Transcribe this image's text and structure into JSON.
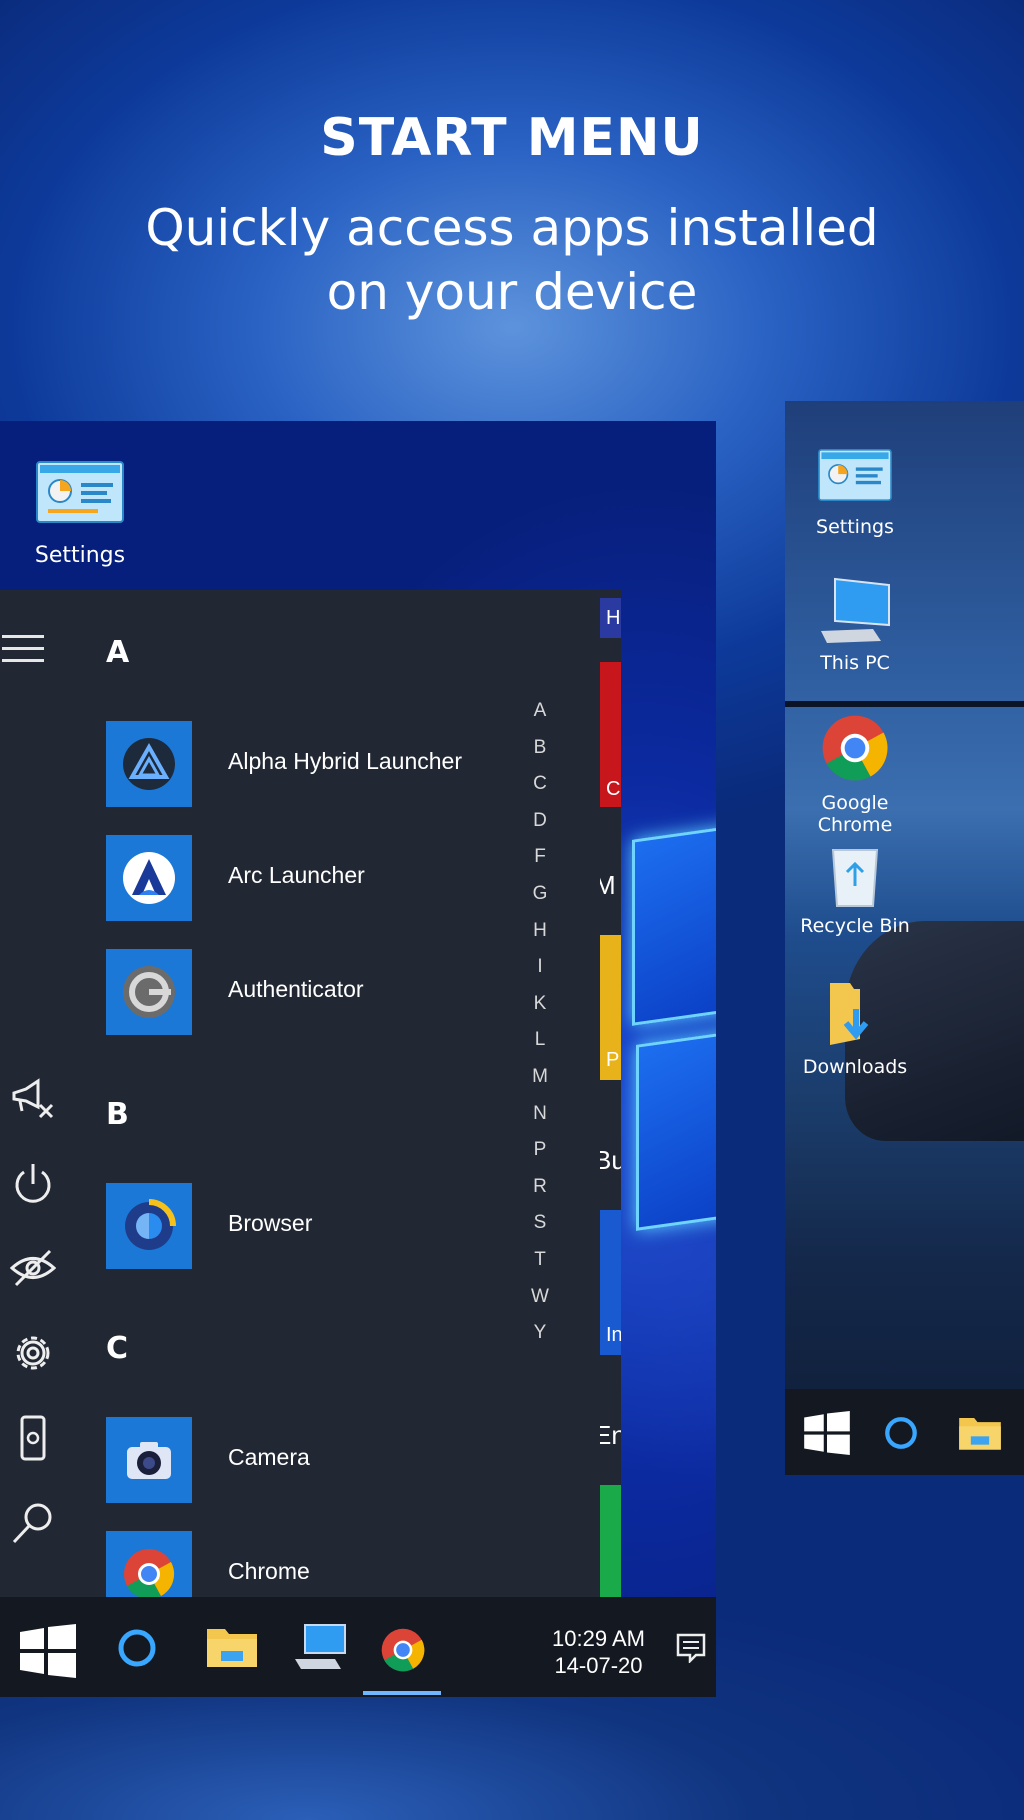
{
  "headline": {
    "title": "START MENU",
    "line1": "Quickly access apps installed",
    "line2": "on your device"
  },
  "phone1": {
    "desktop_settings_label": "Settings",
    "start_menu": {
      "sections": [
        {
          "letter": "A",
          "apps": [
            "Alpha Hybrid Launcher",
            "Arc Launcher",
            "Authenticator"
          ]
        },
        {
          "letter": "B",
          "apps": [
            "Browser"
          ]
        },
        {
          "letter": "C",
          "apps": [
            "Camera",
            "Chrome"
          ]
        }
      ],
      "alphabet": [
        "A",
        "B",
        "C",
        "D",
        "F",
        "G",
        "H",
        "I",
        "K",
        "L",
        "M",
        "N",
        "P",
        "R",
        "S",
        "T",
        "W",
        "Y"
      ],
      "tile_fragments": [
        "H",
        "C",
        "M",
        "P",
        "Bu",
        "In",
        "En"
      ],
      "tile_colors": {
        "navy": "#2a3aa0",
        "red": "#c8161d",
        "yellow": "#e7b21a",
        "blue": "#1a5ad0",
        "green": "#1aaa4a"
      }
    },
    "taskbar": {
      "time": "10:29 AM",
      "date": "14-07-20"
    }
  },
  "phone2": {
    "desktop_items": [
      "Settings",
      "This PC",
      "Google Chrome",
      "Recycle Bin",
      "Downloads"
    ]
  },
  "colors": {
    "accent": "#1b78d6",
    "menu_bg": "#222833",
    "taskbar_bg": "#141820",
    "window_glow": "#6fd4ff"
  }
}
